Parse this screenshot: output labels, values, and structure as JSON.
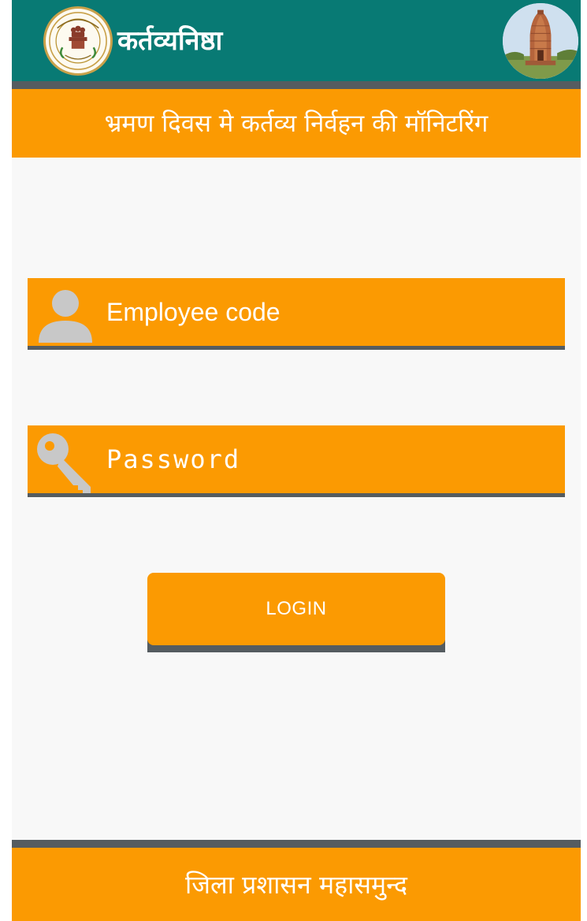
{
  "header": {
    "app_title": "कर्तव्यनिष्ठा",
    "logo_icon": "chhattisgarh-emblem-icon",
    "profile_icon": "temple-avatar-icon",
    "bar_color": "#087a74"
  },
  "banner": {
    "subtitle": "भ्रमण दिवस मे कर्तव्य निर्वहन की मॉनिटरिंग"
  },
  "form": {
    "employee_code": {
      "placeholder": "Employee code",
      "value": "",
      "icon": "person-icon"
    },
    "password": {
      "placeholder": "Password",
      "value": "",
      "icon": "key-icon"
    },
    "login_label": "LOGIN"
  },
  "footer": {
    "text": "जिला प्रशासन महासमुन्द"
  },
  "colors": {
    "accent": "#fb9a02",
    "shadow": "#555c60",
    "background": "#f8f8f8"
  }
}
